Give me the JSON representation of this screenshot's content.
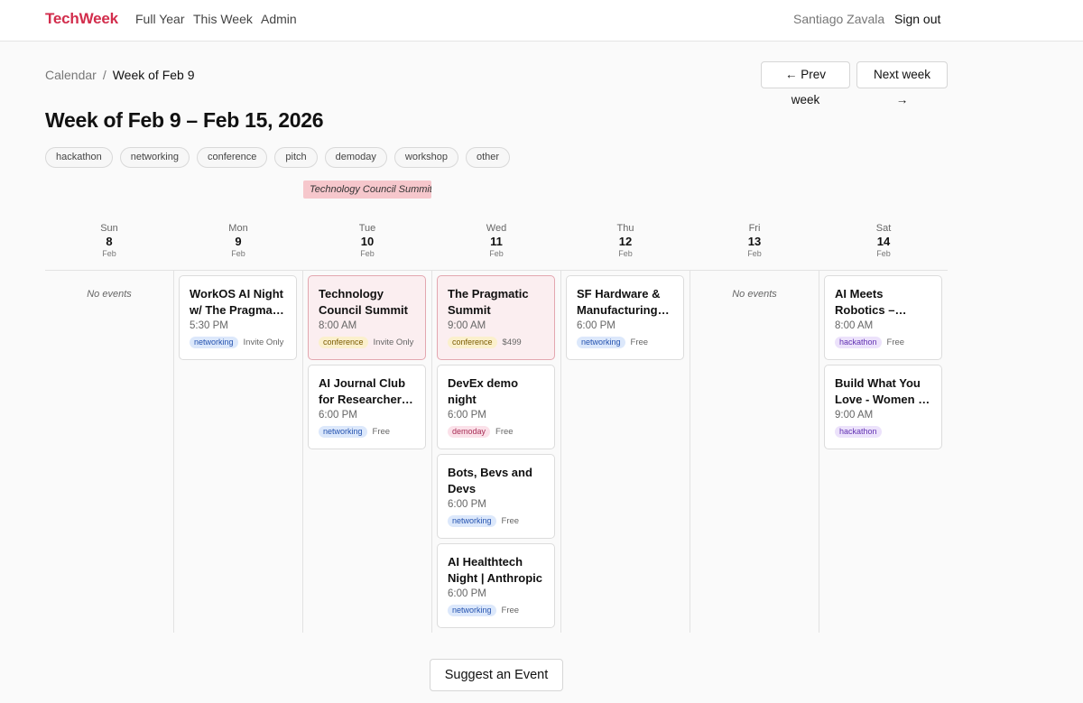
{
  "nav": {
    "brand": "TechWeek",
    "links": [
      "Full Year",
      "This Week",
      "Admin"
    ],
    "user": "Santiago Zavala",
    "sign_out": "Sign out"
  },
  "breadcrumb": {
    "root": "Calendar",
    "separator": "/",
    "current": "Week of Feb 9"
  },
  "week_nav": {
    "prev": "← Prev week",
    "next": "Next week →"
  },
  "page_title": "Week of Feb 9 – Feb 15, 2026",
  "filters": [
    "hackathon",
    "networking",
    "conference",
    "pitch",
    "demoday",
    "workshop",
    "other"
  ],
  "banner": "Technology Council Summit",
  "days": [
    {
      "dow": "Sun",
      "num": "8",
      "mon": "Feb"
    },
    {
      "dow": "Mon",
      "num": "9",
      "mon": "Feb"
    },
    {
      "dow": "Tue",
      "num": "10",
      "mon": "Feb"
    },
    {
      "dow": "Wed",
      "num": "11",
      "mon": "Feb"
    },
    {
      "dow": "Thu",
      "num": "12",
      "mon": "Feb"
    },
    {
      "dow": "Fri",
      "num": "13",
      "mon": "Feb"
    },
    {
      "dow": "Sat",
      "num": "14",
      "mon": "Feb"
    }
  ],
  "no_events": "No events",
  "events": {
    "mon_0": {
      "title": "WorkOS AI Night w/ The Pragmatic Engineer",
      "time": "5:30 PM",
      "tag": "networking",
      "price": "Invite Only"
    },
    "tue_0": {
      "title": "Technology Council Summit",
      "time": "8:00 AM",
      "tag": "conference",
      "price": "Invite Only"
    },
    "tue_1": {
      "title": "AI Journal Club for Researchers & Engineers",
      "time": "6:00 PM",
      "tag": "networking",
      "price": "Free"
    },
    "wed_0": {
      "title": "The Pragmatic Summit",
      "time": "9:00 AM",
      "tag": "conference",
      "price": "$499"
    },
    "wed_1": {
      "title": "DevEx demo night",
      "time": "6:00 PM",
      "tag": "demoday",
      "price": "Free"
    },
    "wed_2": {
      "title": "Bots, Bevs and Devs",
      "time": "6:00 PM",
      "tag": "networking",
      "price": "Free"
    },
    "wed_3": {
      "title": "AI Healthtech Night | Anthropic",
      "time": "6:00 PM",
      "tag": "networking",
      "price": "Free"
    },
    "thu_0": {
      "title": "SF Hardware & Manufacturing Meetup",
      "time": "6:00 PM",
      "tag": "networking",
      "price": "Free"
    },
    "sat_0": {
      "title": "AI Meets Robotics – Launch & Fund",
      "time": "8:00 AM",
      "tag": "hackathon",
      "price": "Free"
    },
    "sat_1": {
      "title": "Build What You Love - Women in AI",
      "time": "9:00 AM",
      "tag": "hackathon",
      "price": ""
    }
  },
  "suggest_button": "Suggest an Event",
  "colors": {
    "brand": "#d22d4c",
    "highlight_card": "#fbeef0",
    "banner": "#f6c7cc"
  }
}
